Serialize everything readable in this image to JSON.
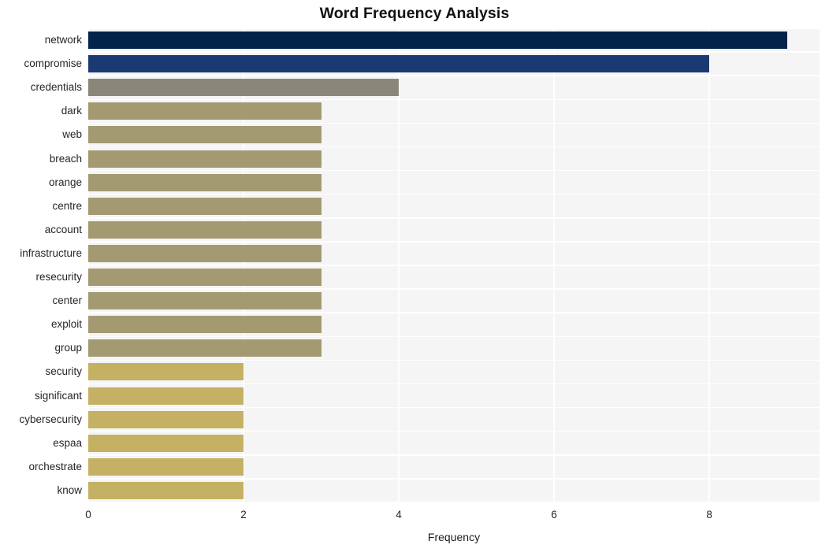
{
  "chart_data": {
    "type": "bar",
    "orientation": "horizontal",
    "title": "Word Frequency Analysis",
    "xlabel": "Frequency",
    "ylabel": "",
    "categories": [
      "network",
      "compromise",
      "credentials",
      "dark",
      "web",
      "breach",
      "orange",
      "centre",
      "account",
      "infrastructure",
      "resecurity",
      "center",
      "exploit",
      "group",
      "security",
      "significant",
      "cybersecurity",
      "espaa",
      "orchestrate",
      "know"
    ],
    "values": [
      9,
      8,
      4,
      3,
      3,
      3,
      3,
      3,
      3,
      3,
      3,
      3,
      3,
      3,
      2,
      2,
      2,
      2,
      2,
      2
    ],
    "bar_colors": [
      "#04234b",
      "#1c3a72",
      "#89877a",
      "#a39a72",
      "#a39a72",
      "#a39a72",
      "#a39a72",
      "#a39a72",
      "#a39a72",
      "#a39a72",
      "#a39a72",
      "#a39a72",
      "#a39a72",
      "#a39a72",
      "#c4b163",
      "#c4b163",
      "#c4b163",
      "#c4b163",
      "#c4b163",
      "#c4b163"
    ],
    "xlim": [
      0,
      9.42
    ],
    "xticks": [
      0,
      2,
      4,
      6,
      8
    ],
    "xtick_labels": [
      "0",
      "2",
      "4",
      "6",
      "8"
    ],
    "grid": true,
    "grid_color": "#ffffff",
    "plot_background": "#f5f5f5",
    "figure_background": "#ffffff",
    "legend": null
  }
}
